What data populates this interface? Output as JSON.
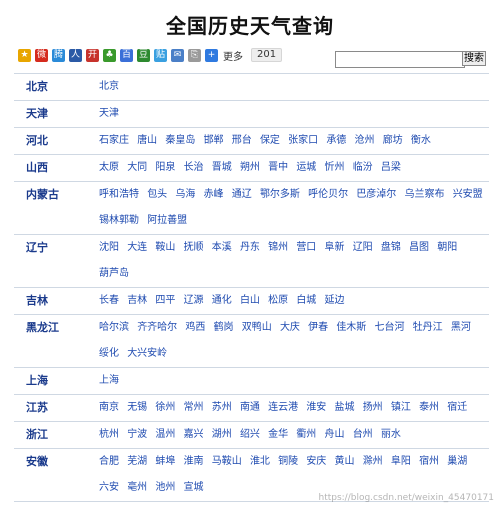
{
  "page": {
    "title": "全国历史天气查询"
  },
  "share": {
    "icons": [
      {
        "name": "qzone-icon",
        "color": "#e8a600",
        "glyph": "★"
      },
      {
        "name": "sina-weibo-icon",
        "color": "#d52b1e",
        "glyph": "微"
      },
      {
        "name": "tencent-weibo-icon",
        "color": "#2a8ad8",
        "glyph": "腾"
      },
      {
        "name": "renren-icon",
        "color": "#2b5aa6",
        "glyph": "人"
      },
      {
        "name": "kaixin-icon",
        "color": "#c7332c",
        "glyph": "开"
      },
      {
        "name": "clover-icon",
        "color": "#3a9a2c",
        "glyph": "♣"
      },
      {
        "name": "baidu-icon",
        "color": "#3a6fd8",
        "glyph": "百"
      },
      {
        "name": "douban-icon",
        "color": "#2d8a2f",
        "glyph": "豆"
      },
      {
        "name": "tieba-icon",
        "color": "#3aa0e0",
        "glyph": "贴"
      },
      {
        "name": "mail-icon",
        "color": "#4a7fc7",
        "glyph": "✉"
      },
      {
        "name": "copy-icon",
        "color": "#9a9a9a",
        "glyph": "⎘"
      },
      {
        "name": "plus-icon",
        "color": "#2f7ae0",
        "glyph": "+"
      }
    ],
    "more_label": "更多",
    "count": "201"
  },
  "search": {
    "placeholder": "",
    "value": "",
    "button_label": "搜索"
  },
  "provinces": [
    {
      "name": "北京",
      "cities": [
        "北京"
      ]
    },
    {
      "name": "天津",
      "cities": [
        "天津"
      ]
    },
    {
      "name": "河北",
      "cities": [
        "石家庄",
        "唐山",
        "秦皇岛",
        "邯郸",
        "邢台",
        "保定",
        "张家口",
        "承德",
        "沧州",
        "廊坊",
        "衡水"
      ]
    },
    {
      "name": "山西",
      "cities": [
        "太原",
        "大同",
        "阳泉",
        "长治",
        "晋城",
        "朔州",
        "晋中",
        "运城",
        "忻州",
        "临汾",
        "吕梁"
      ]
    },
    {
      "name": "内蒙古",
      "cities": [
        "呼和浩特",
        "包头",
        "乌海",
        "赤峰",
        "通辽",
        "鄂尔多斯",
        "呼伦贝尔",
        "巴彦淖尔",
        "乌兰察布",
        "兴安盟",
        "锡林郭勒",
        "阿拉善盟"
      ]
    },
    {
      "name": "辽宁",
      "cities": [
        "沈阳",
        "大连",
        "鞍山",
        "抚顺",
        "本溪",
        "丹东",
        "锦州",
        "营口",
        "阜新",
        "辽阳",
        "盘锦",
        "昌图",
        "朝阳",
        "葫芦岛"
      ]
    },
    {
      "name": "吉林",
      "cities": [
        "长春",
        "吉林",
        "四平",
        "辽源",
        "通化",
        "白山",
        "松原",
        "白城",
        "延边"
      ]
    },
    {
      "name": "黑龙江",
      "cities": [
        "哈尔滨",
        "齐齐哈尔",
        "鸡西",
        "鹤岗",
        "双鸭山",
        "大庆",
        "伊春",
        "佳木斯",
        "七台河",
        "牡丹江",
        "黑河",
        "绥化",
        "大兴安岭"
      ]
    },
    {
      "name": "上海",
      "cities": [
        "上海"
      ]
    },
    {
      "name": "江苏",
      "cities": [
        "南京",
        "无锡",
        "徐州",
        "常州",
        "苏州",
        "南通",
        "连云港",
        "淮安",
        "盐城",
        "扬州",
        "镇江",
        "泰州",
        "宿迁"
      ]
    },
    {
      "name": "浙江",
      "cities": [
        "杭州",
        "宁波",
        "温州",
        "嘉兴",
        "湖州",
        "绍兴",
        "金华",
        "衢州",
        "舟山",
        "台州",
        "丽水"
      ]
    },
    {
      "name": "安徽",
      "cities": [
        "合肥",
        "芜湖",
        "蚌埠",
        "淮南",
        "马鞍山",
        "淮北",
        "铜陵",
        "安庆",
        "黄山",
        "滁州",
        "阜阳",
        "宿州",
        "巢湖",
        "六安",
        "亳州",
        "池州",
        "宣城"
      ]
    }
  ],
  "watermark": "https://blog.csdn.net/weixin_45470171"
}
